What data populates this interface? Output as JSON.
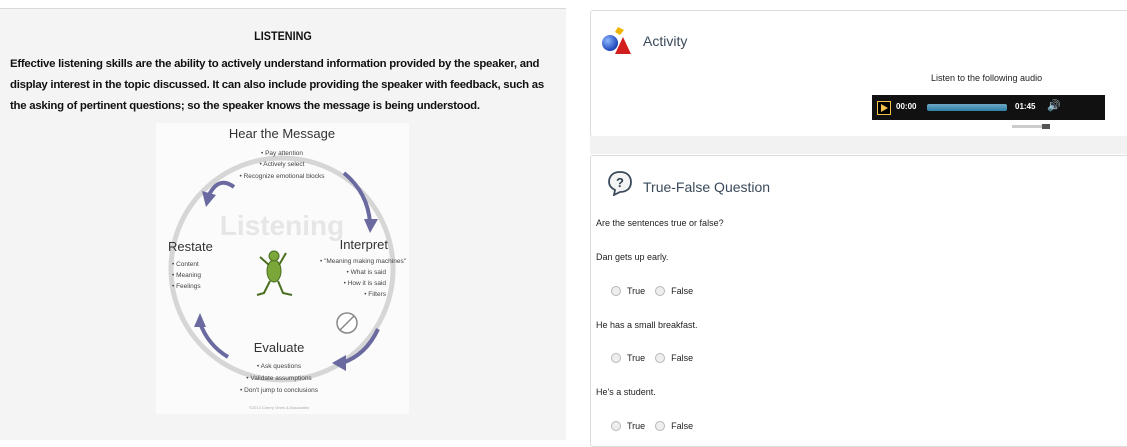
{
  "reading": {
    "title": "LISTENING",
    "paragraph": "Effective listening skills are the ability to actively understand information provided by the speaker, and display interest in the topic discussed. It can also include providing the speaker with feedback, such as the asking of pertinent questions; so the speaker knows the message is being understood.",
    "diagram": {
      "center": "Listening",
      "top_heading": "Hear the Message",
      "top_items": [
        "• Pay attention",
        "• Actively select",
        "• Recognize emotional blocks"
      ],
      "right_heading": "Interpret",
      "right_items": [
        "• \"Meaning making machines\"",
        "• What is said",
        "• How it is said",
        "• Filters"
      ],
      "bottom_heading": "Evaluate",
      "bottom_items": [
        "• Ask questions",
        "• Validate assumptions",
        "• Don't jump to conclusions"
      ],
      "left_heading": "Restate",
      "left_items": [
        "• Content",
        "• Meaning",
        "• Feelings"
      ],
      "footer": "©2013 Cherry Vines & Associates"
    }
  },
  "activity": {
    "title": "Activity",
    "instruction": "Listen to the following audio",
    "player": {
      "current": "00:00",
      "duration": "01:45",
      "volume_icon": "speaker-icon"
    }
  },
  "question": {
    "title": "True-False Question",
    "prompt": "Are the sentences true or false?",
    "items": [
      {
        "sentence": "Dan gets up early."
      },
      {
        "sentence": "He has a small breakfast."
      },
      {
        "sentence": "He's a student."
      }
    ],
    "option_true": "True",
    "option_false": "False"
  }
}
